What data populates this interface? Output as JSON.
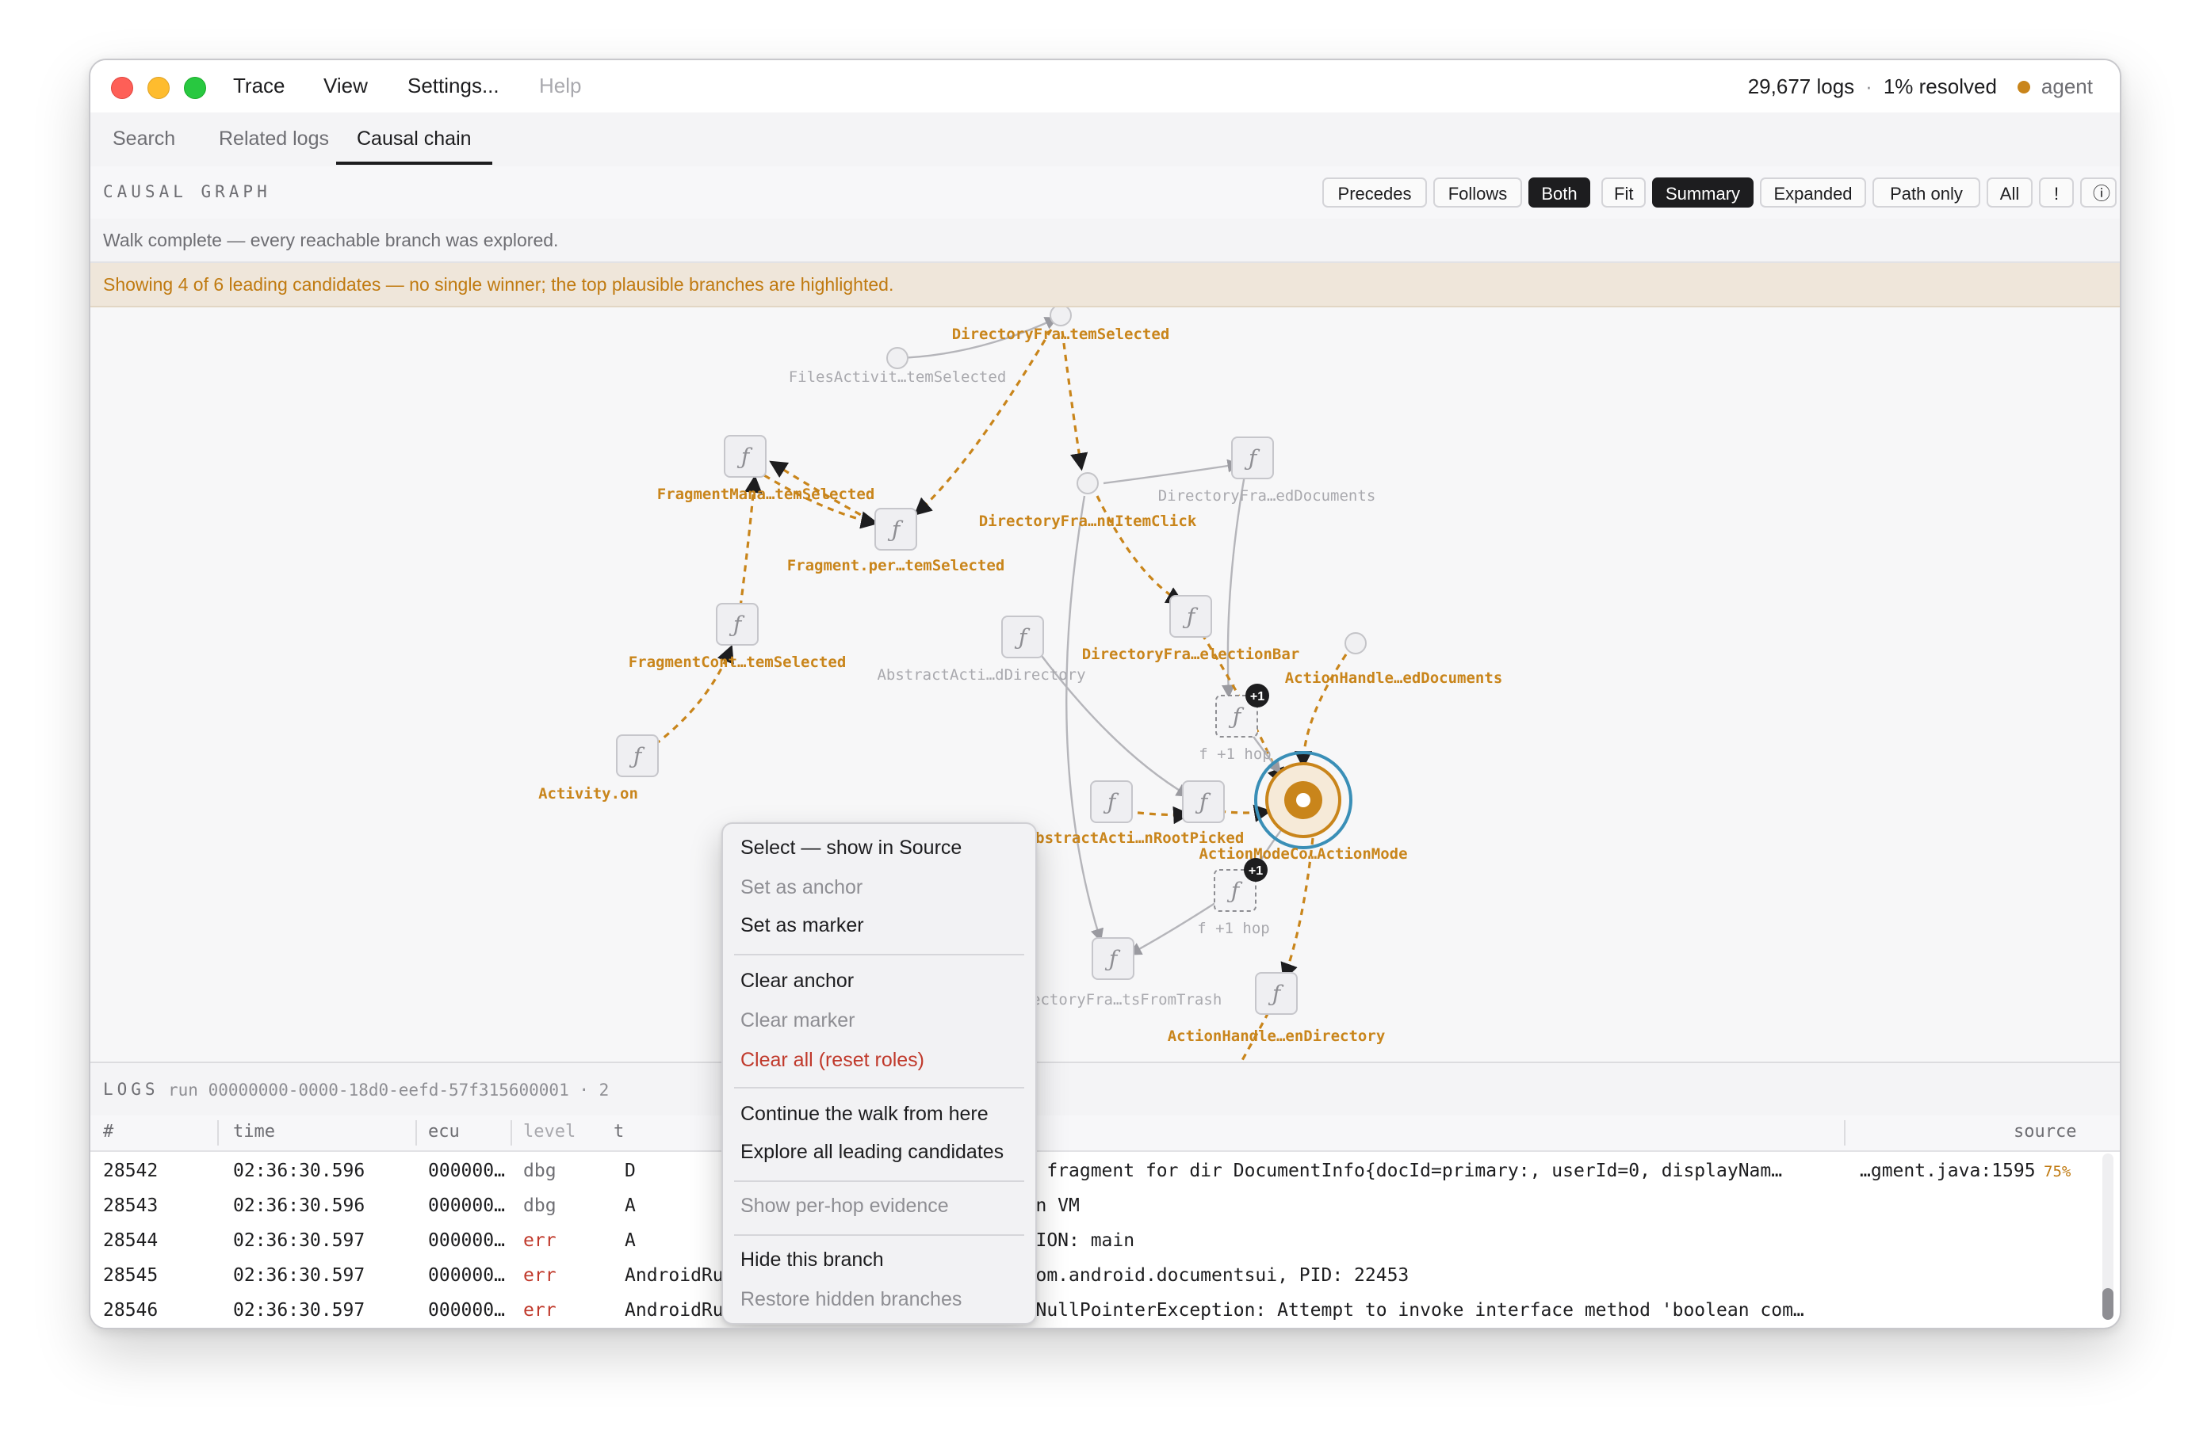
{
  "titlebar": {
    "menus": [
      "Trace",
      "View",
      "Settings...",
      "Help"
    ],
    "log_count": "29,677 logs",
    "separator": "·",
    "resolved": "1% resolved",
    "agent": "agent"
  },
  "tabs": [
    "Search",
    "Related logs",
    "Causal chain"
  ],
  "active_tab": "Causal chain",
  "graph_panel": {
    "title": "CAUSAL GRAPH",
    "direction_buttons": [
      "Precedes",
      "Follows",
      "Both"
    ],
    "active_direction": "Both",
    "view_buttons": [
      "Fit",
      "Summary",
      "Expanded",
      "Path only",
      "All",
      "!",
      "ⓘ"
    ],
    "active_view": "Summary",
    "status": "Walk complete — every reachable branch was explored.",
    "banner": "Showing 4 of 6 leading candidates — no single winner; the top plausible branches are highlighted.",
    "accent_color": "#c9851b",
    "muted_color": "#b5b5ba",
    "target_ring_color": "#3a8fb7"
  },
  "graph": {
    "nodes": [
      {
        "id": "n1",
        "label": "DirectoryFra…temSelected",
        "kind": "circle",
        "highlight": true
      },
      {
        "id": "n2",
        "label": "FilesActivit…temSelected",
        "kind": "circle",
        "highlight": false
      },
      {
        "id": "n3",
        "label": "FragmentMana…temSelected",
        "kind": "fn",
        "highlight": true
      },
      {
        "id": "n4",
        "label": "Fragment.per…temSelected",
        "kind": "fn",
        "highlight": true
      },
      {
        "id": "n5",
        "label": "DirectoryFra…nuItemClick",
        "kind": "circle",
        "highlight": true
      },
      {
        "id": "n6",
        "label": "DirectoryFra…edDocuments",
        "kind": "fn",
        "highlight": false
      },
      {
        "id": "n7",
        "label": "FragmentCont…temSelected",
        "kind": "fn",
        "highlight": true
      },
      {
        "id": "n8",
        "label": "AbstractActi…dDirectory",
        "kind": "fn",
        "highlight": false
      },
      {
        "id": "n9",
        "label": "DirectoryFra…electionBar",
        "kind": "fn",
        "highlight": true
      },
      {
        "id": "n10",
        "label": "ActionHandle…edDocuments",
        "kind": "circle",
        "highlight": true
      },
      {
        "id": "n11",
        "label": "f  +1 hop",
        "kind": "hop",
        "badge": "+1",
        "highlight": false
      },
      {
        "id": "n12",
        "label": "Activity.on",
        "kind": "fn",
        "highlight": true
      },
      {
        "id": "n13",
        "label": "AbstractActi…nRootPicked",
        "kind": "fn",
        "highlight": true
      },
      {
        "id": "n14",
        "label": "",
        "kind": "fn",
        "highlight": true
      },
      {
        "id": "n15",
        "label": "ActionModeCo…ActionMode",
        "kind": "target",
        "highlight": true
      },
      {
        "id": "n16",
        "label": "f  +1 hop",
        "kind": "hop",
        "badge": "+1",
        "highlight": false
      },
      {
        "id": "n17",
        "label": "DirectoryFra…tsFromTrash",
        "kind": "fn",
        "highlight": false
      },
      {
        "id": "n18",
        "label": "ActionHandle…enDirectory",
        "kind": "fn",
        "highlight": true
      }
    ],
    "node_glyph": "ƒ"
  },
  "logs": {
    "title": "LOGS",
    "run": "run 00000000-0000-18d0-eefd-57f315600001 · 2",
    "columns": [
      "#",
      "time",
      "ecu",
      "level",
      "t",
      "xt",
      "source"
    ],
    "rows": [
      {
        "id": "28542",
        "time": "02:36:30.596",
        "ecu": "000000…",
        "level": "dbg",
        "tag": "D",
        "text": "eating new fragment for dir DocumentInfo{docId=primary:, userId=0, displayNam…",
        "source": "…gment.java:1595",
        "pct": "75%"
      },
      {
        "id": "28543",
        "time": "02:36:30.596",
        "ecu": "000000…",
        "level": "dbg",
        "tag": "A",
        "text": "utting down VM",
        "source": "",
        "pct": ""
      },
      {
        "id": "28544",
        "time": "02:36:30.597",
        "ecu": "000000…",
        "level": "err",
        "tag": "A",
        "text": "TAL EXCEPTION: main",
        "source": "",
        "pct": ""
      },
      {
        "id": "28545",
        "time": "02:36:30.597",
        "ecu": "000000…",
        "level": "err",
        "tag": "AndroidRuntime",
        "text": "Process: com.android.documentsui, PID: 22453",
        "source": "",
        "pct": ""
      },
      {
        "id": "28546",
        "time": "02:36:30.597",
        "ecu": "000000…",
        "level": "err",
        "tag": "AndroidRuntime",
        "text": "java.lang.NullPointerException: Attempt to invoke interface method 'boolean com…",
        "source": "",
        "pct": ""
      }
    ]
  },
  "context_menu": {
    "items": [
      {
        "label": "Select — show in Source",
        "state": "enabled"
      },
      {
        "label": "Set as anchor",
        "state": "disabled"
      },
      {
        "label": "Set as marker",
        "state": "enabled"
      },
      {
        "label": "Clear anchor",
        "state": "enabled"
      },
      {
        "label": "Clear marker",
        "state": "disabled"
      },
      {
        "label": "Clear all (reset roles)",
        "state": "danger"
      },
      {
        "label": "Continue the walk from here",
        "state": "enabled"
      },
      {
        "label": "Explore all leading candidates",
        "state": "enabled"
      },
      {
        "label": "Show per-hop evidence",
        "state": "disabled"
      },
      {
        "label": "Hide this branch",
        "state": "enabled"
      },
      {
        "label": "Restore hidden branches",
        "state": "disabled"
      }
    ]
  }
}
